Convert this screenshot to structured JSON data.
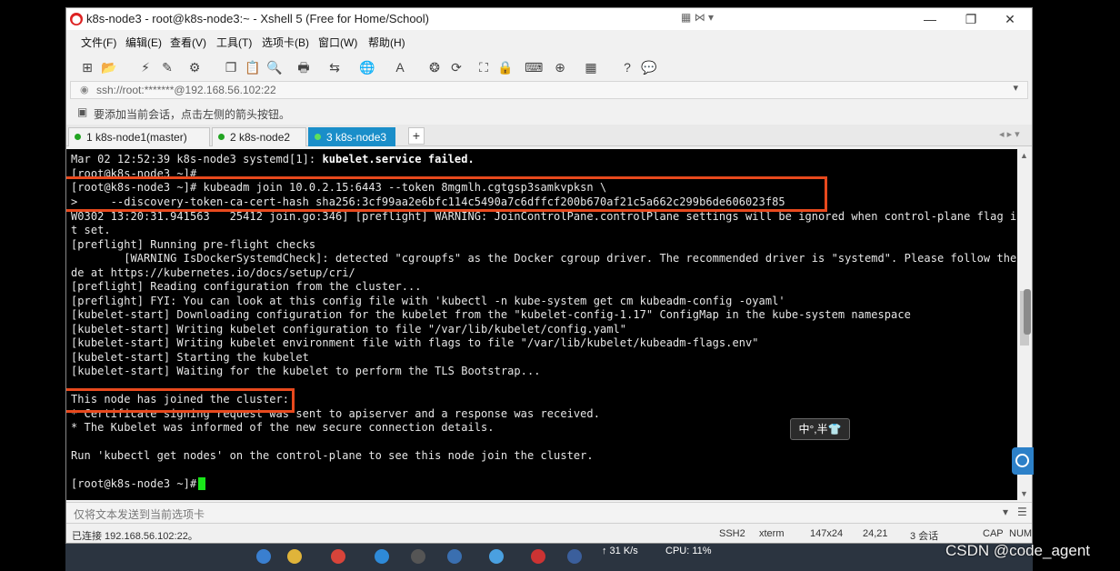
{
  "window": {
    "title": "k8s-node3 - root@k8s-node3:~ - Xshell 5 (Free for Home/School)",
    "app_icon": "xshell-logo-icon",
    "minimize": "—",
    "maximize": "❐",
    "close": "✕",
    "title_tools": "▦ ⋈ ▾"
  },
  "menu": [
    "文件(F)",
    "编辑(E)",
    "查看(V)",
    "工具(T)",
    "选项卡(B)",
    "窗口(W)",
    "帮助(H)"
  ],
  "address": {
    "value": "ssh://root:*******@192.168.56.102:22",
    "lock_icon": "◉",
    "dropdown": "▾"
  },
  "hint": {
    "text": "要添加当前会话，点击左侧的箭头按钮。",
    "icon": "▣"
  },
  "tabs": [
    {
      "label": "1 k8s-node1(master)",
      "active": false
    },
    {
      "label": "2 k8s-node2",
      "active": false
    },
    {
      "label": "3 k8s-node3",
      "active": true
    }
  ],
  "tab_add": "+",
  "tab_nav": "◂ ▸ ▾",
  "terminal": {
    "lines": [
      "Mar 02 12:52:39 k8s-node3 systemd[1]: ",
      "[root@k8s-node3 ~]#",
      "[root@k8s-node3 ~]# kubeadm join 10.0.2.15:6443 --token 8mgmlh.cgtgsp3samkvpksn \\",
      ">     --discovery-token-ca-cert-hash sha256:3cf99aa2e6bfc114c5490a7c6dffcf200b670af21c5a662c299b6de606023f85",
      "W0302 13:20:31.941563   25412 join.go:346] [preflight] WARNING: JoinControlPane.controlPlane settings will be ignored when control-plane flag is no",
      "t set.",
      "[preflight] Running pre-flight checks",
      "        [WARNING IsDockerSystemdCheck]: detected \"cgroupfs\" as the Docker cgroup driver. The recommended driver is \"systemd\". Please follow the gui",
      "de at https://kubernetes.io/docs/setup/cri/",
      "[preflight] Reading configuration from the cluster...",
      "[preflight] FYI: You can look at this config file with 'kubectl -n kube-system get cm kubeadm-config -oyaml'",
      "[kubelet-start] Downloading configuration for the kubelet from the \"kubelet-config-1.17\" ConfigMap in the kube-system namespace",
      "[kubelet-start] Writing kubelet configuration to file \"/var/lib/kubelet/config.yaml\"",
      "[kubelet-start] Writing kubelet environment file with flags to file \"/var/lib/kubelet/kubeadm-flags.env\"",
      "[kubelet-start] Starting the kubelet",
      "[kubelet-start] Waiting for the kubelet to perform the TLS Bootstrap...",
      "",
      "This node has joined the cluster:",
      "* Certificate signing request was sent to apiserver and a response was received.",
      "* The Kubelet was informed of the new secure connection details.",
      "",
      "Run 'kubectl get nodes' on the control-plane to see this node join the cluster.",
      "",
      "[root@k8s-node3 ~]# "
    ],
    "bold_fragment": "kubelet.service failed."
  },
  "ime_badge": "中°,半👕",
  "sendbar": {
    "placeholder": "仅将文本发送到当前选项卡",
    "menu": "▾",
    "list": "☰"
  },
  "status": {
    "connected": "已连接 192.168.56.102:22。",
    "protocol": "SSH2",
    "term": "xterm",
    "size": "147x24",
    "cursor": "24,21",
    "sessions": "3 会话",
    "cap": "CAP",
    "num": "NUM"
  },
  "taskbar": {
    "net": "↑ 31 K/s",
    "cpu": "CPU: 11%"
  },
  "watermark": "CSDN @code_agent",
  "colors": {
    "tab_active": "#1a8ec9",
    "highlight": "#e8491d",
    "cursor": "#19e619"
  }
}
